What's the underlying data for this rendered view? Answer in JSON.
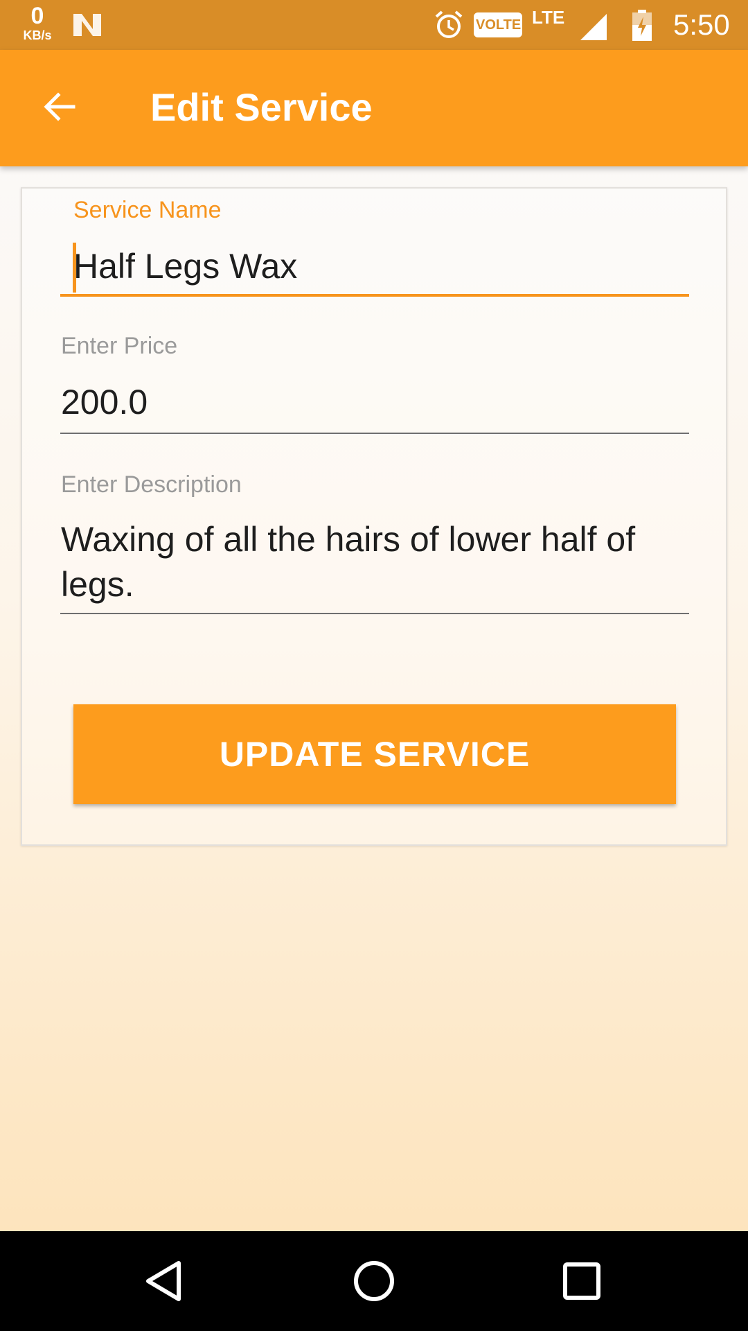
{
  "status_bar": {
    "net_speed_value": "0",
    "net_speed_unit": "KB/s",
    "volte_label": "VOLTE",
    "network_type": "LTE",
    "time": "5:50",
    "icons": [
      "n-icon",
      "alarm-icon",
      "signal-icon",
      "battery-icon"
    ]
  },
  "app_bar": {
    "title": "Edit Service",
    "back_icon": "arrow-back-icon",
    "color": "#fd9c1d"
  },
  "form": {
    "service_name": {
      "label": "Service Name",
      "value": "Half Legs Wax",
      "focused": true
    },
    "price": {
      "label": "Enter Price",
      "value": "200.0"
    },
    "description": {
      "label": "Enter Description",
      "value": "Waxing of all the hairs of lower half of legs."
    },
    "submit_label": "UPDATE SERVICE"
  },
  "nav_bar": {
    "icons": [
      "back-triangle-icon",
      "home-circle-icon",
      "recents-square-icon"
    ]
  },
  "colors": {
    "accent": "#f7941d",
    "status_bar": "#d98d27"
  }
}
